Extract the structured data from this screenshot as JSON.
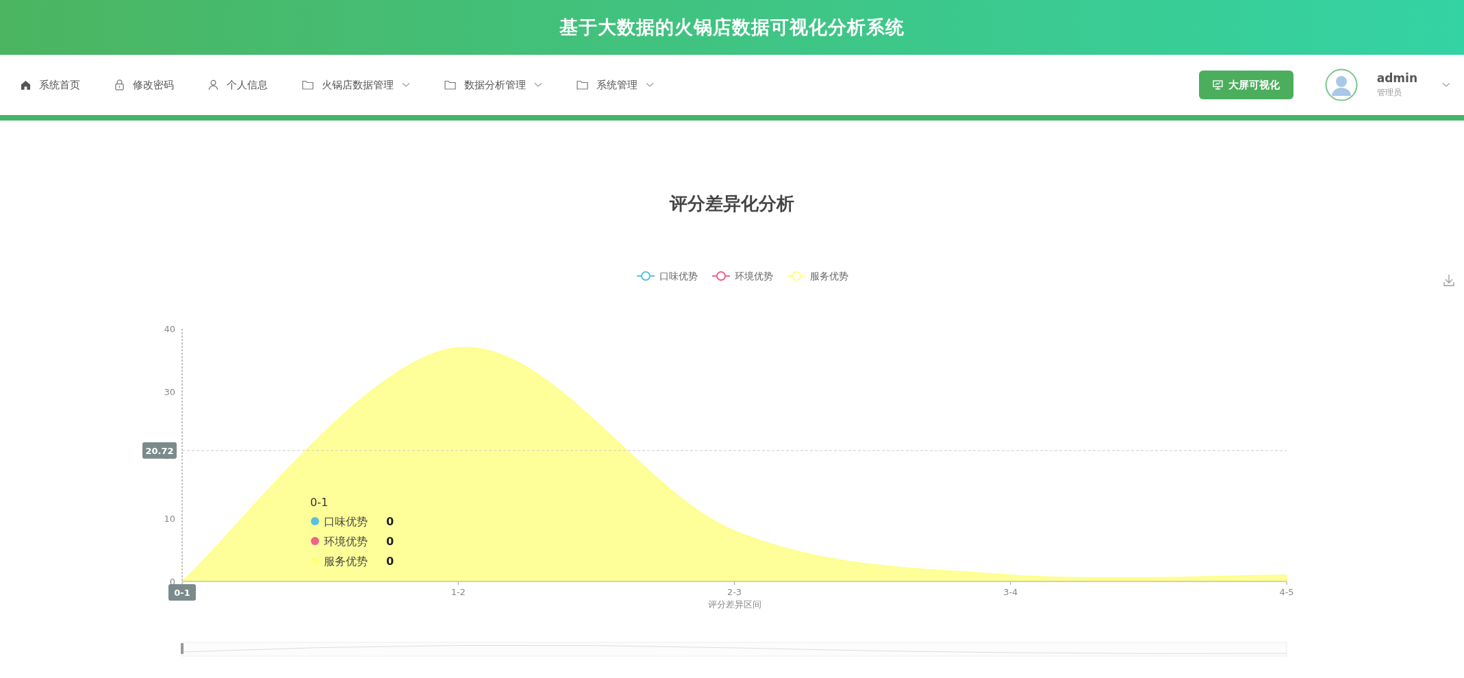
{
  "header": {
    "title": "基于大数据的火锅店数据可视化分析系统"
  },
  "nav": {
    "items": [
      {
        "label": "系统首页",
        "kind": "home",
        "dropdown": false
      },
      {
        "label": "修改密码",
        "kind": "lock",
        "dropdown": false
      },
      {
        "label": "个人信息",
        "kind": "user",
        "dropdown": false
      },
      {
        "label": "火锅店数据管理",
        "kind": "folder",
        "dropdown": true
      },
      {
        "label": "数据分析管理",
        "kind": "folder",
        "dropdown": true
      },
      {
        "label": "系统管理",
        "kind": "folder",
        "dropdown": true
      }
    ],
    "screen_button": "大屏可视化",
    "user": {
      "name": "admin",
      "role": "管理员"
    }
  },
  "chart": {
    "chart_data": {
      "type": "area",
      "title": "评分差异化分析",
      "xlabel": "评分差异区间",
      "legend": "top",
      "categories": [
        "0-1",
        "1-2",
        "2-3",
        "3-4",
        "4-5"
      ],
      "series": [
        {
          "name": "口味优势",
          "color": "#5bc0de",
          "values": [
            null,
            null,
            null,
            null,
            null
          ]
        },
        {
          "name": "环境优势",
          "color": "#f0628a",
          "values": [
            null,
            null,
            null,
            null,
            null
          ]
        },
        {
          "name": "服务优势",
          "color": "#ffff80",
          "values": [
            0,
            37,
            8,
            1,
            1
          ]
        }
      ],
      "ref_lines": [
        {
          "axis": "y",
          "value": 20.72,
          "label": "20.72"
        }
      ],
      "ylim": [
        0,
        40
      ],
      "yticks": [
        0,
        10,
        20,
        30,
        40
      ]
    },
    "tooltip": {
      "title": "0-1",
      "rows": [
        {
          "name": "口味优势",
          "value": "0"
        },
        {
          "name": "环境优势",
          "value": "0"
        },
        {
          "name": "服务优势",
          "value": "0"
        }
      ]
    }
  }
}
